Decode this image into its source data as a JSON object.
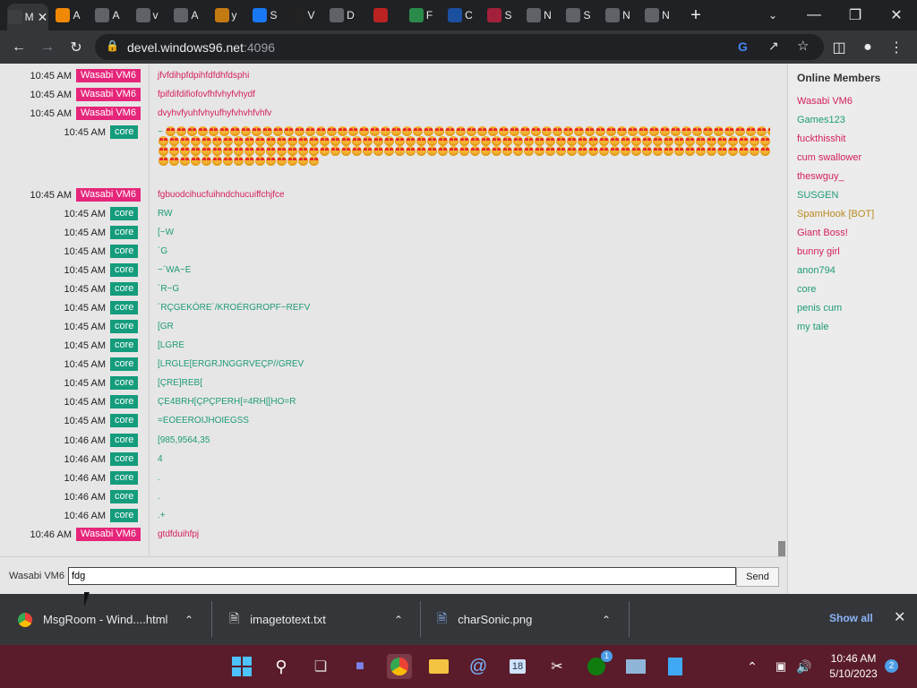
{
  "browser": {
    "tabs": [
      {
        "label": "M",
        "icon": "msgroom-icon",
        "color": "#3c4043"
      },
      {
        "label": "A",
        "icon": "amazon-icon",
        "color": "#f08804"
      },
      {
        "label": "A",
        "icon": "chromium-icon",
        "color": "#5f6368"
      },
      {
        "label": "v",
        "icon": "globe-icon",
        "color": "#5f6368"
      },
      {
        "label": "A",
        "icon": "chromium-icon",
        "color": "#5f6368"
      },
      {
        "label": "y",
        "icon": "ch-icon",
        "color": "#c47a12"
      },
      {
        "label": "S",
        "icon": "facebook-icon",
        "color": "#1877f2"
      },
      {
        "label": "V",
        "icon": "wtf-icon",
        "color": "#222"
      },
      {
        "label": "D",
        "icon": "download-icon",
        "color": "#5f6368"
      },
      {
        "label": "",
        "icon": "shield-crest-icon",
        "color": "#b22"
      },
      {
        "label": "F",
        "icon": "globe-green-icon",
        "color": "#2a8a4a"
      },
      {
        "label": "C",
        "icon": "earth-icon",
        "color": "#1b4fa0"
      },
      {
        "label": "S",
        "icon": "target-icon",
        "color": "#a3203a"
      },
      {
        "label": "N",
        "icon": "chrome-icon",
        "color": "#5f6368"
      },
      {
        "label": "S",
        "icon": "gear-icon",
        "color": "#5f6368"
      },
      {
        "label": "N",
        "icon": "chromium-icon",
        "color": "#5f6368"
      },
      {
        "label": "N",
        "icon": "chromium-icon",
        "color": "#5f6368"
      }
    ],
    "url_host": "devel.windows96.net",
    "url_port": ":4096"
  },
  "chat": {
    "messages": [
      {
        "time": "10:45 AM",
        "user": "Wasabi VM6",
        "kind": "wasabi",
        "text": "jfvfdihpfdpihfdfdhfdsphi"
      },
      {
        "time": "10:45 AM",
        "user": "Wasabi VM6",
        "kind": "wasabi",
        "text": "fpifdifdifiofovfhfvhyfvhydf"
      },
      {
        "time": "10:45 AM",
        "user": "Wasabi VM6",
        "kind": "wasabi",
        "text": "dvyhvfyuhfvhyufhyfvhvhfvhfv"
      },
      {
        "time": "10:45 AM",
        "user": "core",
        "kind": "core",
        "text": "~"
      },
      {
        "time": "10:45 AM",
        "user": "Wasabi VM6",
        "kind": "wasabi",
        "text": "fgbuodcihucfuihndchucuiffchjfce"
      },
      {
        "time": "10:45 AM",
        "user": "core",
        "kind": "core",
        "text": "RW"
      },
      {
        "time": "10:45 AM",
        "user": "core",
        "kind": "core",
        "text": "[~W"
      },
      {
        "time": "10:45 AM",
        "user": "core",
        "kind": "core",
        "text": "´G"
      },
      {
        "time": "10:45 AM",
        "user": "core",
        "kind": "core",
        "text": "~´WA~E"
      },
      {
        "time": "10:45 AM",
        "user": "core",
        "kind": "core",
        "text": "´R~G"
      },
      {
        "time": "10:45 AM",
        "user": "core",
        "kind": "core",
        "text": "´RÇGEKÓRE´/KROÉRGROPF~REFV"
      },
      {
        "time": "10:45 AM",
        "user": "core",
        "kind": "core",
        "text": "[GR"
      },
      {
        "time": "10:45 AM",
        "user": "core",
        "kind": "core",
        "text": "[LGRE"
      },
      {
        "time": "10:45 AM",
        "user": "core",
        "kind": "core",
        "text": "[LRGLE[ERGRJNGGRVEÇP//GREV"
      },
      {
        "time": "10:45 AM",
        "user": "core",
        "kind": "core",
        "text": "[ÇRE]REB["
      },
      {
        "time": "10:45 AM",
        "user": "core",
        "kind": "core",
        "text": "ÇE4BRH[ÇPÇPERH[=4RH[[HO=R"
      },
      {
        "time": "10:45 AM",
        "user": "core",
        "kind": "core",
        "text": "=EOEEROIJHOIEGSS"
      },
      {
        "time": "10:46 AM",
        "user": "core",
        "kind": "core",
        "text": "[985,9564,35"
      },
      {
        "time": "10:46 AM",
        "user": "core",
        "kind": "core",
        "text": "4"
      },
      {
        "time": "10:46 AM",
        "user": "core",
        "kind": "core",
        "text": "."
      },
      {
        "time": "10:46 AM",
        "user": "core",
        "kind": "core",
        "text": "."
      },
      {
        "time": "10:46 AM",
        "user": "core",
        "kind": "core",
        "text": ".+"
      },
      {
        "time": "10:46 AM",
        "user": "Wasabi VM6",
        "kind": "wasabi",
        "text": "gtdfduihfpj"
      }
    ],
    "nick": "Wasabi VM6",
    "input_value": "fdg",
    "send_label": "Send"
  },
  "members": {
    "title": "Online Members",
    "list": [
      {
        "name": "Wasabi VM6",
        "color": "#d4205e"
      },
      {
        "name": "Games123",
        "color": "#1e9a78"
      },
      {
        "name": "fuckthisshit",
        "color": "#d4205e"
      },
      {
        "name": "cum swallower",
        "color": "#d4205e"
      },
      {
        "name": "theswguy_",
        "color": "#d4205e"
      },
      {
        "name": "SUSGEN",
        "color": "#1e9a78"
      },
      {
        "name": "SpamHook [BOT]",
        "color": "#b98a22"
      },
      {
        "name": "Giant Boss!",
        "color": "#d4205e"
      },
      {
        "name": "bunny girl",
        "color": "#d4205e"
      },
      {
        "name": "anon794",
        "color": "#1e9a78"
      },
      {
        "name": "core",
        "color": "#1e9a78"
      },
      {
        "name": "penis cum",
        "color": "#1e9a78"
      },
      {
        "name": "my tale",
        "color": "#1e9a78"
      }
    ]
  },
  "downloads": {
    "items": [
      {
        "name": "MsgRoom - Wind....html",
        "icon": "chrome-icon"
      },
      {
        "name": "imagetotext.txt",
        "icon": "file-icon"
      },
      {
        "name": "charSonic.png",
        "icon": "image-file-icon"
      }
    ],
    "show_all": "Show all"
  },
  "taskbar": {
    "time": "10:46 AM",
    "date": "5/10/2023",
    "notifications": "2",
    "calendar_badge": "18",
    "xbox_badge": "1"
  },
  "colors": {
    "wasabi": "#e6267b",
    "core": "#149c7c"
  }
}
